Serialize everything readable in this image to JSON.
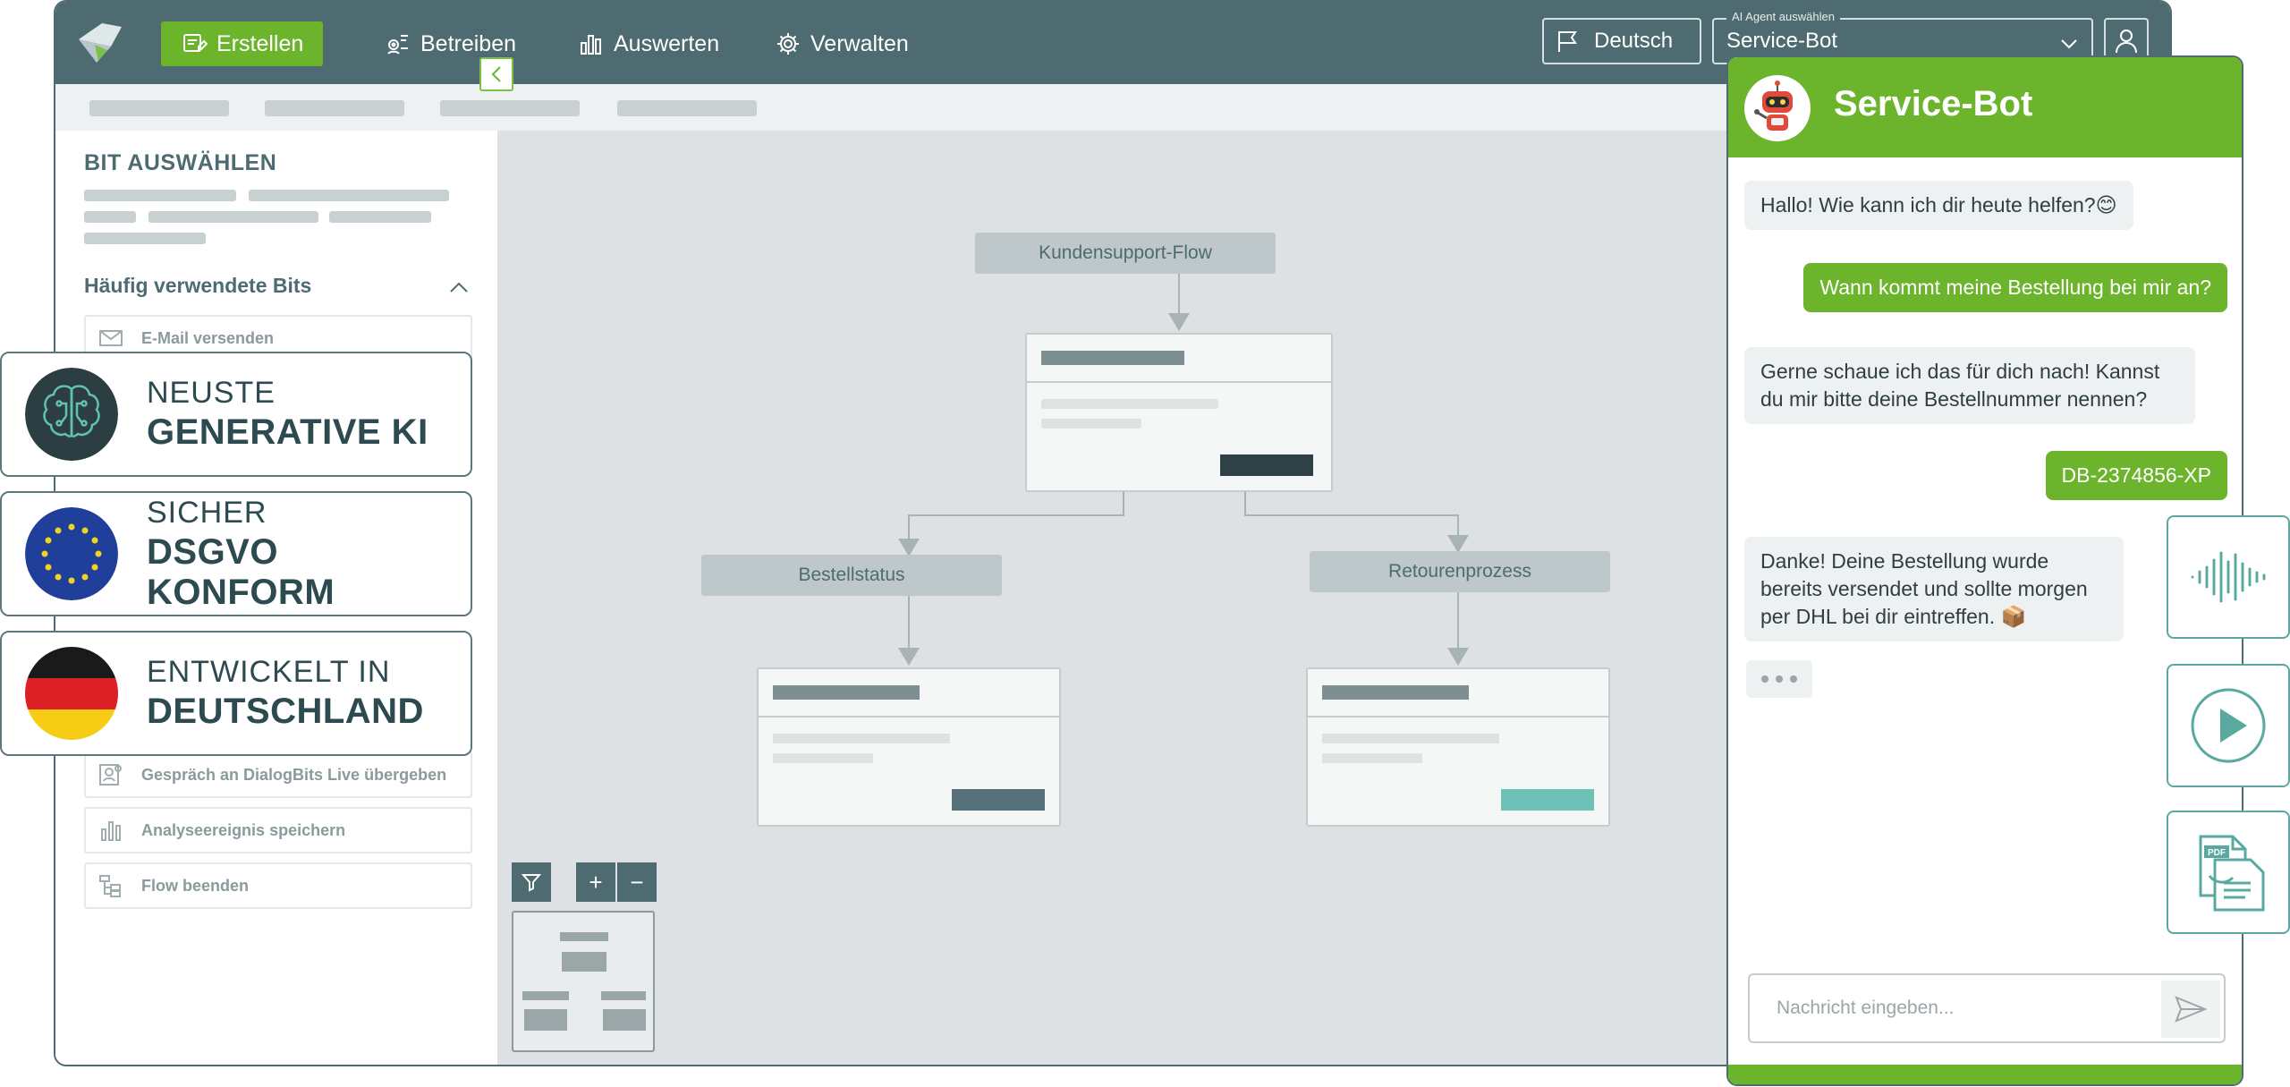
{
  "nav": {
    "items": [
      {
        "label": "Erstellen",
        "icon": "create-icon",
        "active": true
      },
      {
        "label": "Betreiben",
        "icon": "operate-icon",
        "active": false
      },
      {
        "label": "Auswerten",
        "icon": "bar-chart-icon",
        "active": false
      },
      {
        "label": "Verwalten",
        "icon": "gear-icon",
        "active": false
      }
    ],
    "language": "Deutsch",
    "agent_select_legend": "AI Agent auswählen",
    "agent_select_value": "Service-Bot"
  },
  "sidebar": {
    "title": "BIT AUSWÄHLEN",
    "section_title": "Häufig verwendete Bits",
    "bits": [
      {
        "label": "E-Mail versenden",
        "icon": "mail-icon"
      },
      {
        "label": "Gespräch an DialogBits Live übergeben",
        "icon": "handover-icon"
      },
      {
        "label": "Analyseereignis speichern",
        "icon": "bar-chart-icon"
      },
      {
        "label": "Flow beenden",
        "icon": "flow-end-icon"
      }
    ]
  },
  "canvas": {
    "root_label": "Kundensupport-Flow",
    "left_label": "Bestellstatus",
    "right_label": "Retourenprozess",
    "zoom_in": "+",
    "zoom_out": "−"
  },
  "badges": [
    {
      "line1": "NEUSTE",
      "line2": "GENERATIVE KI",
      "icon": "brain-circuit-icon"
    },
    {
      "line1": "SICHER",
      "line2": "DSGVO KONFORM",
      "icon": "eu-flag-icon"
    },
    {
      "line1": "ENTWICKELT IN",
      "line2": "DEUTSCHLAND",
      "icon": "german-flag-icon"
    }
  ],
  "chat": {
    "title": "Service-Bot",
    "messages": [
      {
        "from": "bot",
        "text": "Hallo! Wie kann ich dir heute helfen?😊"
      },
      {
        "from": "user",
        "text": "Wann kommt meine Bestellung bei mir an?"
      },
      {
        "from": "bot",
        "text": "Gerne schaue ich das für dich nach! Kannst du mir bitte deine Bestellnummer nennen?"
      },
      {
        "from": "user",
        "text": "DB-2374856-XP"
      },
      {
        "from": "bot",
        "text": "Danke! Deine Bestellung wurde bereits versendet und sollte morgen per DHL bei dir eintreffen. 📦"
      }
    ],
    "input_placeholder": "Nachricht eingeben..."
  },
  "side_tiles": [
    {
      "icon": "audio-waveform-icon"
    },
    {
      "icon": "play-icon"
    },
    {
      "icon": "pdf-document-icon",
      "label": "PDF"
    }
  ],
  "colors": {
    "primary": "#4e6b71",
    "accent_green": "#6cb42c",
    "teal": "#5aa9a0",
    "canvas_bg": "#dde1e3"
  }
}
